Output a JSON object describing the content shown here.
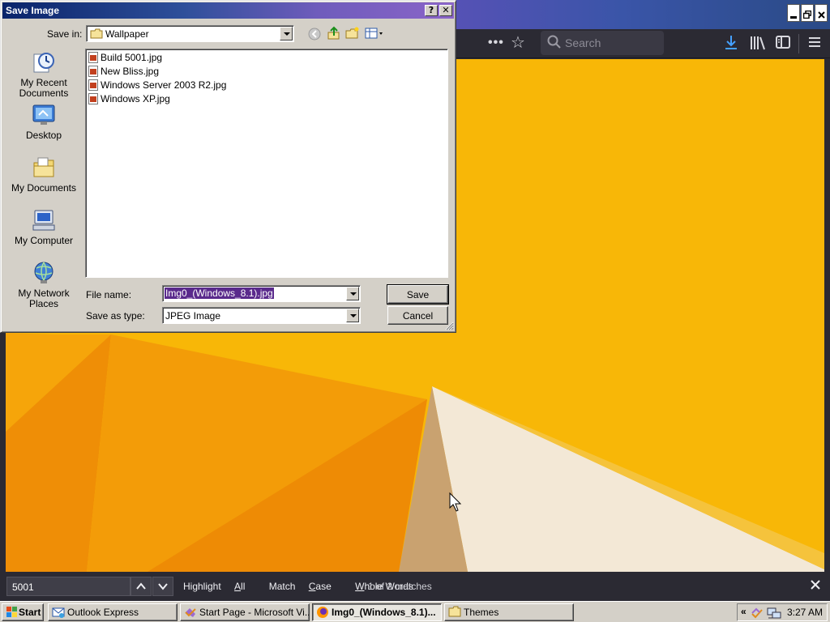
{
  "browser": {
    "search_placeholder": "Search",
    "window_controls": [
      "minimize",
      "restore",
      "close"
    ],
    "toolbar_icons": [
      "more-icon",
      "bookmark-star-icon",
      "search-icon",
      "download-icon",
      "library-icon",
      "sidebar-icon",
      "menu-icon"
    ],
    "content_colors": {
      "primary": "#f7b507",
      "dark": "#ee8a06",
      "light": "#f4ead8"
    }
  },
  "dialog": {
    "title": "Save Image",
    "help_button": "?",
    "close_button": "✕",
    "save_in_label": "Save in:",
    "save_in_value": "Wallpaper",
    "places": [
      {
        "label_line1": "My Recent",
        "label_line2": "Documents"
      },
      {
        "label_line1": "Desktop",
        "label_line2": ""
      },
      {
        "label_line1": "My Documents",
        "label_line2": ""
      },
      {
        "label_line1": "My Computer",
        "label_line2": ""
      },
      {
        "label_line1": "My Network",
        "label_line2": "Places"
      }
    ],
    "files": [
      "Build 5001.jpg",
      "New Bliss.jpg",
      "Windows Server 2003 R2.jpg",
      "Windows XP.jpg"
    ],
    "file_name_label": "File name:",
    "file_name_value": "Img0_(Windows_8.1).jpg",
    "save_type_label": "Save as type:",
    "save_type_value": "JPEG Image",
    "save_button": "Save",
    "cancel_button": "Cancel"
  },
  "findbar": {
    "query": "5001",
    "highlight_all_pre": "Highlight ",
    "highlight_all_key": "A",
    "highlight_all_post": "ll",
    "match_case_pre": "Match ",
    "match_case_key": "C",
    "match_case_post": "ase",
    "whole_words_key": "W",
    "whole_words_post": "hole Words",
    "status": "1 of 2 matches"
  },
  "taskbar": {
    "start": "Start",
    "tasks": [
      {
        "label": "Outlook Express",
        "active": false
      },
      {
        "label": "Start Page - Microsoft Vi...",
        "active": false
      },
      {
        "label": "Img0_(Windows_8.1)...",
        "active": true
      },
      {
        "label": "Themes",
        "active": false
      }
    ],
    "tray_chevron": "«",
    "clock": "3:27 AM"
  }
}
